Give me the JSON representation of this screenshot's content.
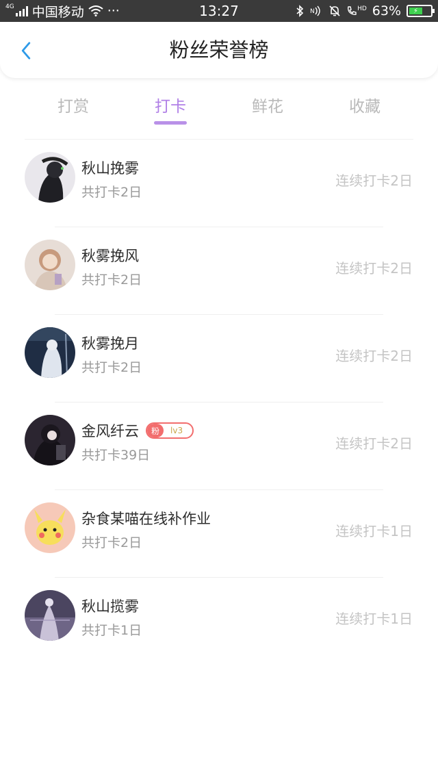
{
  "status_bar": {
    "network_tag": "4G",
    "carrier": "中国移动",
    "more": "···",
    "time": "13:27",
    "hd_tag": "HD",
    "battery_percent": "63%",
    "battery_level": 0.63
  },
  "header": {
    "title": "粉丝荣誉榜"
  },
  "tabs": [
    {
      "label": "打赏",
      "active": false
    },
    {
      "label": "打卡",
      "active": true
    },
    {
      "label": "鲜花",
      "active": false
    },
    {
      "label": "收藏",
      "active": false
    }
  ],
  "rows": [
    {
      "name": "秋山挽雾",
      "total": "共打卡2日",
      "streak": "连续打卡2日"
    },
    {
      "name": "秋雾挽风",
      "total": "共打卡2日",
      "streak": "连续打卡2日"
    },
    {
      "name": "秋雾挽月",
      "total": "共打卡2日",
      "streak": "连续打卡2日"
    },
    {
      "name": "金风纤云",
      "total": "共打卡39日",
      "streak": "连续打卡2日",
      "badge": {
        "left": "粉",
        "right": "lv3"
      }
    },
    {
      "name": "杂食某喵在线补作业",
      "total": "共打卡2日",
      "streak": "连续打卡1日"
    },
    {
      "name": "秋山揽雾",
      "total": "共打卡1日",
      "streak": "连续打卡1日"
    }
  ],
  "colors": {
    "accent": "#b07fe6",
    "status_bar_bg": "#3a3a3a",
    "badge": "#f26d6d",
    "battery": "#3fd04f"
  }
}
